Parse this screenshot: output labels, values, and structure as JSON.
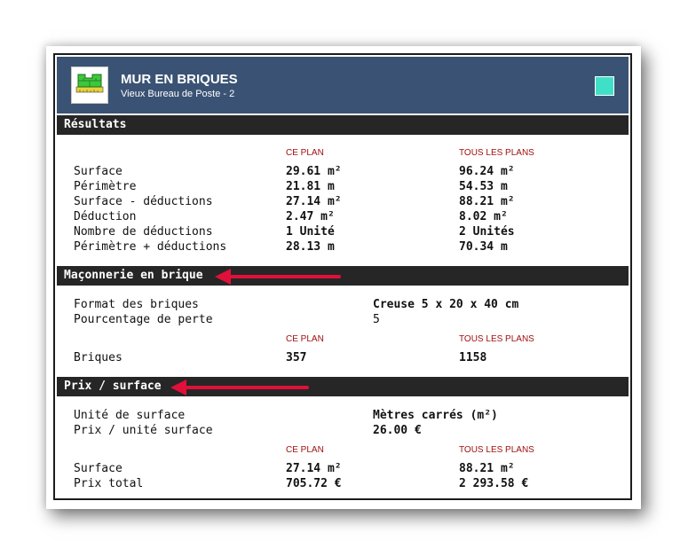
{
  "header": {
    "title": "MUR EN BRIQUES",
    "subtitle": "Vieux Bureau de Poste - 2",
    "swatch_color": "#40e0c8",
    "logo_icon": "brick-wall-icon"
  },
  "columns": {
    "plan": "CE PLAN",
    "all": "TOUS LES PLANS"
  },
  "resultats": {
    "title": "Résultats",
    "rows": [
      {
        "label": "Surface",
        "plan": "29.61 m²",
        "all": "96.24 m²"
      },
      {
        "label": "Périmètre",
        "plan": "21.81 m",
        "all": "54.53 m"
      },
      {
        "label": "Surface - déductions",
        "plan": "27.14 m²",
        "all": "88.21 m²"
      },
      {
        "label": "Déduction",
        "plan": "2.47 m²",
        "all": "8.02 m²"
      },
      {
        "label": "Nombre de déductions",
        "plan": "1 Unité",
        "all": "2 Unités"
      },
      {
        "label": "Périmètre + déductions",
        "plan": "28.13 m",
        "all": "70.34 m"
      }
    ]
  },
  "maconnerie": {
    "title": "Maçonnerie en brique",
    "format_label": "Format des briques",
    "format_value": "Creuse 5 x 20 x 40 cm",
    "perte_label": "Pourcentage de perte",
    "perte_value": "5",
    "briques_label": "Briques",
    "briques_plan": "357",
    "briques_all": "1158"
  },
  "prix": {
    "title": "Prix / surface",
    "unite_label": "Unité de surface",
    "unite_value": "Mètres carrés (m²)",
    "prix_unite_label": "Prix / unité surface",
    "prix_unite_value": "26.00 €",
    "surface_label": "Surface",
    "surface_plan": "27.14 m²",
    "surface_all": "88.21 m²",
    "total_label": "Prix total",
    "total_plan": "705.72 €",
    "total_all": "2 293.58 €"
  },
  "colors": {
    "header_bg": "#3a5374",
    "section_bg": "#262626",
    "column_head": "#a01010",
    "arrow": "#e0103a"
  }
}
